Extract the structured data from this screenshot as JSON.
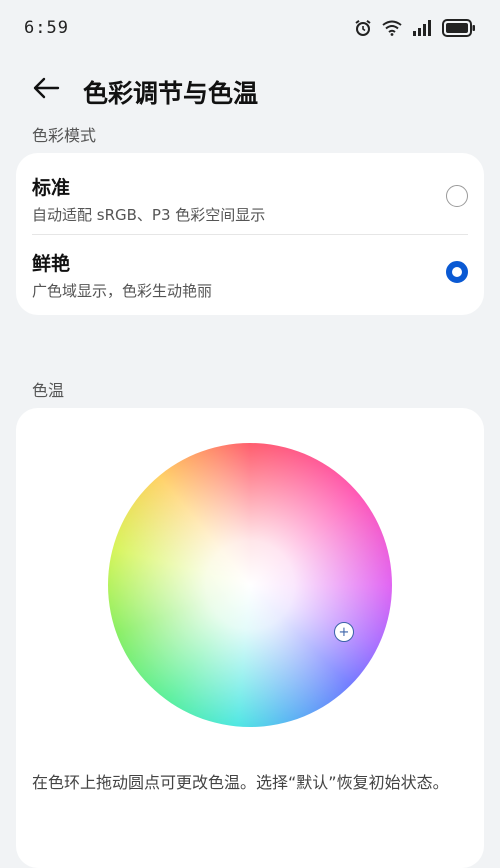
{
  "status_bar": {
    "time": "6:59",
    "icons": [
      "alarm-icon",
      "wifi-icon",
      "signal-icon",
      "battery-icon"
    ]
  },
  "header": {
    "title": "色彩调节与色温",
    "back_icon": "arrow-left-icon"
  },
  "color_mode": {
    "section_label": "色彩模式",
    "options": [
      {
        "title": "标准",
        "description": "自动适配 sRGB、P3 色彩空间显示",
        "selected": false
      },
      {
        "title": "鲜艳",
        "description": "广色域显示，色彩生动艳丽",
        "selected": true
      }
    ]
  },
  "color_temperature": {
    "section_label": "色温",
    "hint": "在色环上拖动圆点可更改色温。选择“默认”恢复初始状态。",
    "handle_symbol": "+"
  },
  "colors": {
    "accent": "#0a59d3",
    "background": "#f1f3f5",
    "card": "#ffffff"
  }
}
